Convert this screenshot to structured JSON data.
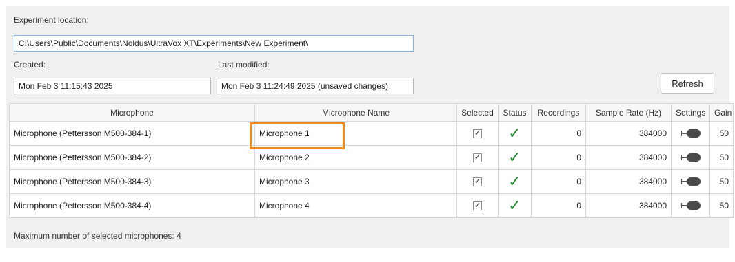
{
  "experiment": {
    "location_label": "Experiment location:",
    "location_value": "C:\\Users\\Public\\Documents\\Noldus\\UltraVox XT\\Experiments\\New Experiment\\",
    "created_label": "Created:",
    "created_value": "Mon Feb 3 11:15:43 2025",
    "modified_label": "Last modified:",
    "modified_value": "Mon Feb 3 11:24:49 2025 (unsaved changes)",
    "refresh_label": "Refresh"
  },
  "table": {
    "headers": [
      "Microphone",
      "Microphone Name",
      "Selected",
      "Status",
      "Recordings",
      "Sample Rate (Hz)",
      "Settings",
      "Gain"
    ],
    "rows": [
      {
        "microphone": "Microphone (Pettersson M500-384-1)",
        "name": "Microphone 1",
        "selected": "✓",
        "status": "✓",
        "recordings": "0",
        "sample_rate": "384000",
        "gain": "50"
      },
      {
        "microphone": "Microphone (Pettersson M500-384-2)",
        "name": "Microphone 2",
        "selected": "✓",
        "status": "✓",
        "recordings": "0",
        "sample_rate": "384000",
        "gain": "50"
      },
      {
        "microphone": "Microphone (Pettersson M500-384-3)",
        "name": "Microphone 3",
        "selected": "✓",
        "status": "✓",
        "recordings": "0",
        "sample_rate": "384000",
        "gain": "50"
      },
      {
        "microphone": "Microphone (Pettersson M500-384-4)",
        "name": "Microphone 4",
        "selected": "✓",
        "status": "✓",
        "recordings": "0",
        "sample_rate": "384000",
        "gain": "50"
      }
    ]
  },
  "footer": {
    "max_selected": "Maximum number of selected microphones: 4"
  },
  "colors": {
    "status_ok": "#1e8a2e",
    "highlight": "#f28a1b"
  },
  "icons": {
    "settings": "toggle-icon",
    "status": "checkmark-icon"
  }
}
